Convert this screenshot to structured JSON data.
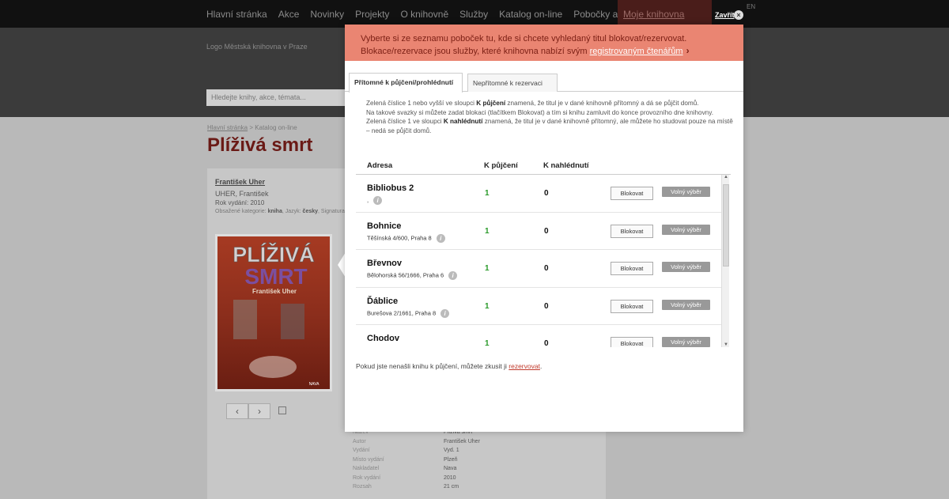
{
  "topnav": {
    "items": [
      "Hlavní stránka",
      "Akce",
      "Novinky",
      "Projekty",
      "O knihovně",
      "Služby",
      "Katalog on-line",
      "Pobočky a kontakty"
    ],
    "moje": "Moje knihovna",
    "close_label": "Zavřít",
    "close_icon": "×",
    "lang": "EN"
  },
  "header": {
    "logo_alt": "Logo Městská knihovna v Praze",
    "search_placeholder": "Hledejte knihy, akce, témata..."
  },
  "breadcrumb": {
    "home": "Hlavní stránka",
    "sep": ">",
    "current": "Katalog on-line"
  },
  "book": {
    "title": "Plíživá smrt",
    "author_link": "František Uher",
    "author_name": "UHER, František",
    "year_label": "Rok vydání: 2010",
    "tags_prefix": "Obsažené kategorie:",
    "tags_kniha": "kniha",
    "tags_mid": "Jazyk:",
    "tags_lang": "česky",
    "tags_suffix": "Signatura",
    "cover_title_1": "PLÍŽIVÁ",
    "cover_title_2": "SMRT",
    "cover_author": "František Uher",
    "cover_publisher": "NAVA"
  },
  "pager": {
    "prev": "‹",
    "next": "›"
  },
  "meta": [
    {
      "k": "Název",
      "v": "Plíživá smrt"
    },
    {
      "k": "Autor",
      "v": "František Uher"
    },
    {
      "k": "Vydání",
      "v": "Vyd. 1"
    },
    {
      "k": "Místo vydání",
      "v": "Plzeň"
    },
    {
      "k": "Nakladatel",
      "v": "Nava"
    },
    {
      "k": "Rok vydání",
      "v": "2010"
    },
    {
      "k": "Rozsah",
      "v": "21 cm"
    }
  ],
  "modal": {
    "alert_line1": "Vyberte si ze seznamu poboček tu, kde si chcete vyhledaný titul blokovat/rezervovat.",
    "alert_line2_prefix": "Blokace/rezervace jsou služby, které knihovna nabízí svým",
    "alert_link": "registrovaným čtenářům",
    "alert_chevron": "›",
    "tab_present": "Přítomné k půjčení/prohlédnutí",
    "tab_absent": "Nepřítomné k rezervaci",
    "info_1a": "Zelená číslice 1 nebo vyšší ve sloupci",
    "info_1b": "K půjčení",
    "info_1c": "znamená, že titul je v dané knihovně přítomný a dá se půjčit domů.",
    "info_2": "Na takové svazky si můžete zadat blokaci (tlačítkem Blokovat) a tím si knihu zamluvit do konce provozního dne knihovny.",
    "info_3a": "Zelená číslice 1 ve sloupci",
    "info_3b": "K nahlédnutí",
    "info_3c": "znamená, že titul je v dané knihovně přítomný, ale můžete ho studovat pouze na místě – nedá se půjčit domů.",
    "col_address": "Adresa",
    "col_k_pujceni": "K půjčení",
    "col_k_nahlednuti": "K nahlédnutí",
    "blok_label": "Blokovat",
    "volny_label": "Volný výběr",
    "rows": [
      {
        "name": "Bibliobus 2",
        "addr": ",",
        "kp": "1",
        "kn": "0"
      },
      {
        "name": "Bohnice",
        "addr": "Těšínská 4/600, Praha 8",
        "kp": "1",
        "kn": "0"
      },
      {
        "name": "Břevnov",
        "addr": "Bělohorská 56/1666, Praha 6",
        "kp": "1",
        "kn": "0"
      },
      {
        "name": "Ďáblice",
        "addr": "Burešova 2/1661, Praha 8",
        "kp": "1",
        "kn": "0"
      },
      {
        "name": "Chodov",
        "addr": "",
        "kp": "1",
        "kn": "0"
      }
    ],
    "footer_prefix": "Pokud jste nenašli knihu k půjčení, můžete zkusit ji",
    "footer_link": "rezervovat",
    "footer_suffix": "."
  }
}
